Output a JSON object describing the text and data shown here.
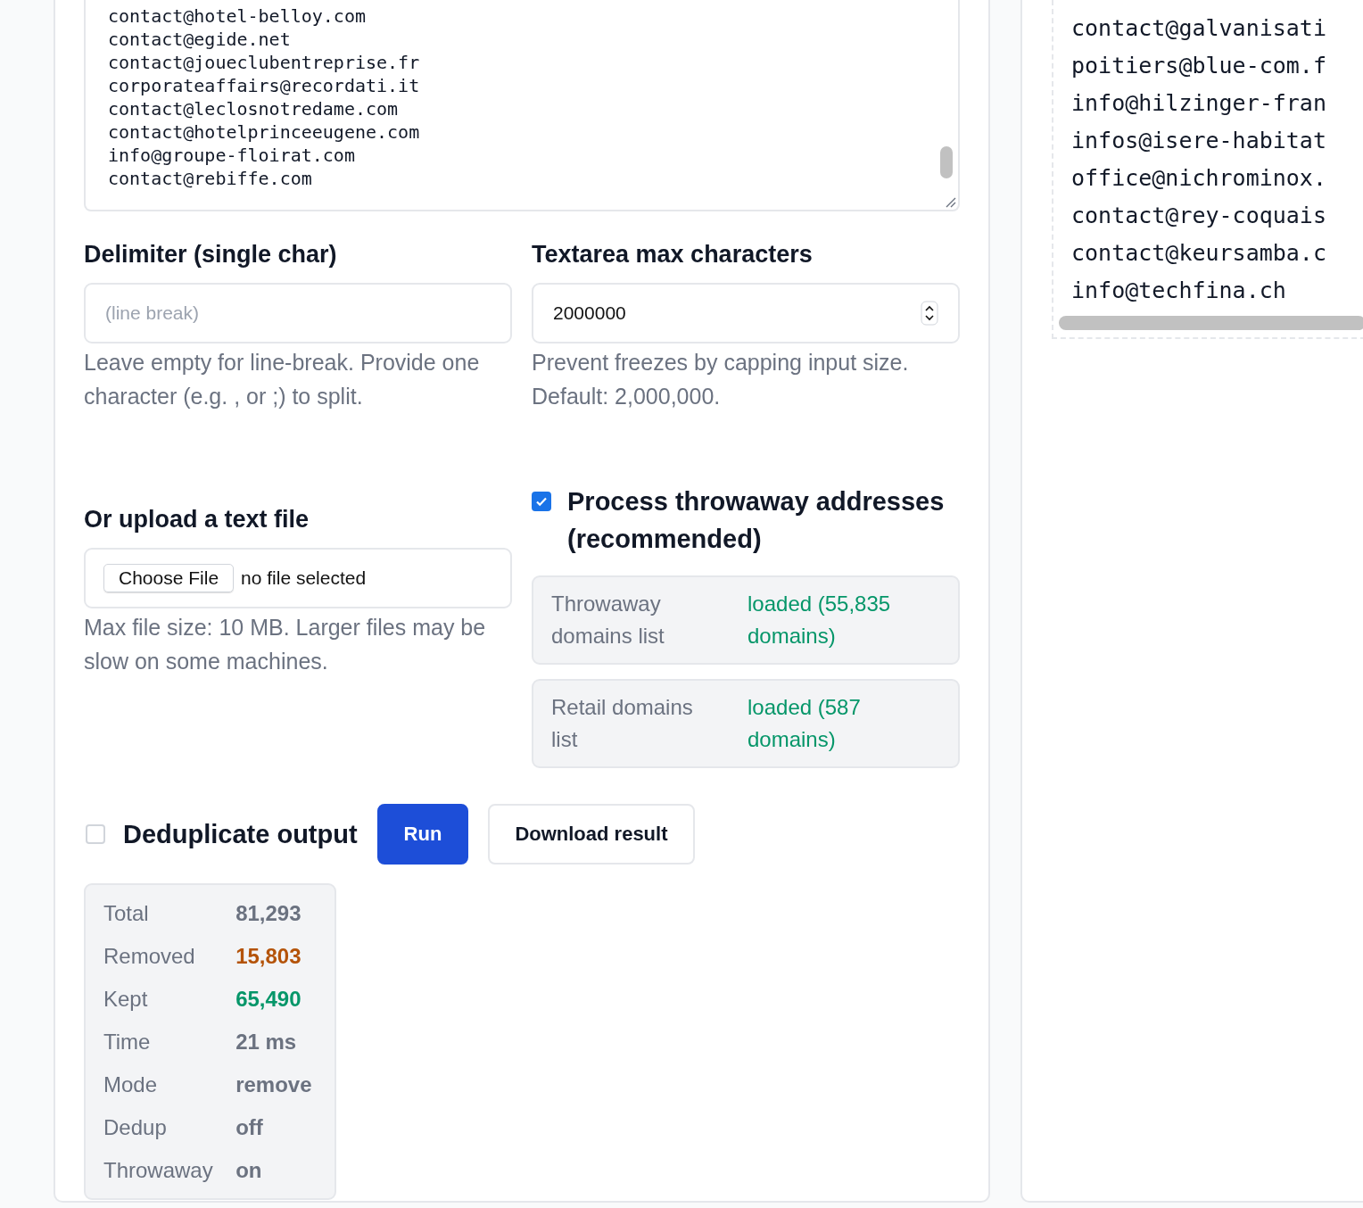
{
  "input_textarea": {
    "lines": [
      "contact@hotel-belloy.com",
      "contact@egide.net",
      "contact@joueclubentreprise.fr",
      "corporateaffairs@recordati.it",
      "contact@leclosnotredame.com",
      "contact@hotelprinceeugene.com",
      "info@groupe-floirat.com",
      "contact@rebiffe.com"
    ]
  },
  "delimiter": {
    "label": "Delimiter (single char)",
    "placeholder": "(line break)",
    "help": "Leave empty for line-break. Provide one character (e.g. , or ;) to split."
  },
  "max_chars": {
    "label": "Textarea max characters",
    "value": "2000000",
    "help": "Prevent freezes by capping input size. Default: 2,000,000."
  },
  "upload": {
    "label": "Or upload a text file",
    "button": "Choose File",
    "status": "no file selected",
    "help": "Max file size: 10 MB. Larger files may be slow on some machines."
  },
  "throwaway": {
    "label": "Process throwaway addresses (recommended)",
    "checked": true
  },
  "lists": [
    {
      "name": "Throwaway domains list",
      "status": "loaded (55,835 domains)"
    },
    {
      "name": "Retail domains list",
      "status": "loaded (587 domains)"
    }
  ],
  "dedup": {
    "label": "Deduplicate output",
    "checked": false
  },
  "buttons": {
    "run": "Run",
    "download": "Download result"
  },
  "stats": [
    {
      "label": "Total",
      "value": "81,293",
      "color": "#6b7280"
    },
    {
      "label": "Removed",
      "value": "15,803",
      "color": "#b45309"
    },
    {
      "label": "Kept",
      "value": "65,490",
      "color": "#059669"
    },
    {
      "label": "Time",
      "value": "21 ms",
      "color": "#6b7280"
    },
    {
      "label": "Mode",
      "value": "remove",
      "color": "#6b7280"
    },
    {
      "label": "Dedup",
      "value": "off",
      "color": "#6b7280"
    },
    {
      "label": "Throwaway",
      "value": "on",
      "color": "#6b7280"
    }
  ],
  "output": {
    "lines": [
      "contact@galvanisati",
      "poitiers@blue-com.f",
      "info@hilzinger-fran",
      "infos@isere-habitat",
      "office@nichrominox.",
      "contact@rey-coquais",
      "contact@keursamba.c",
      "info@techfina.ch"
    ]
  }
}
